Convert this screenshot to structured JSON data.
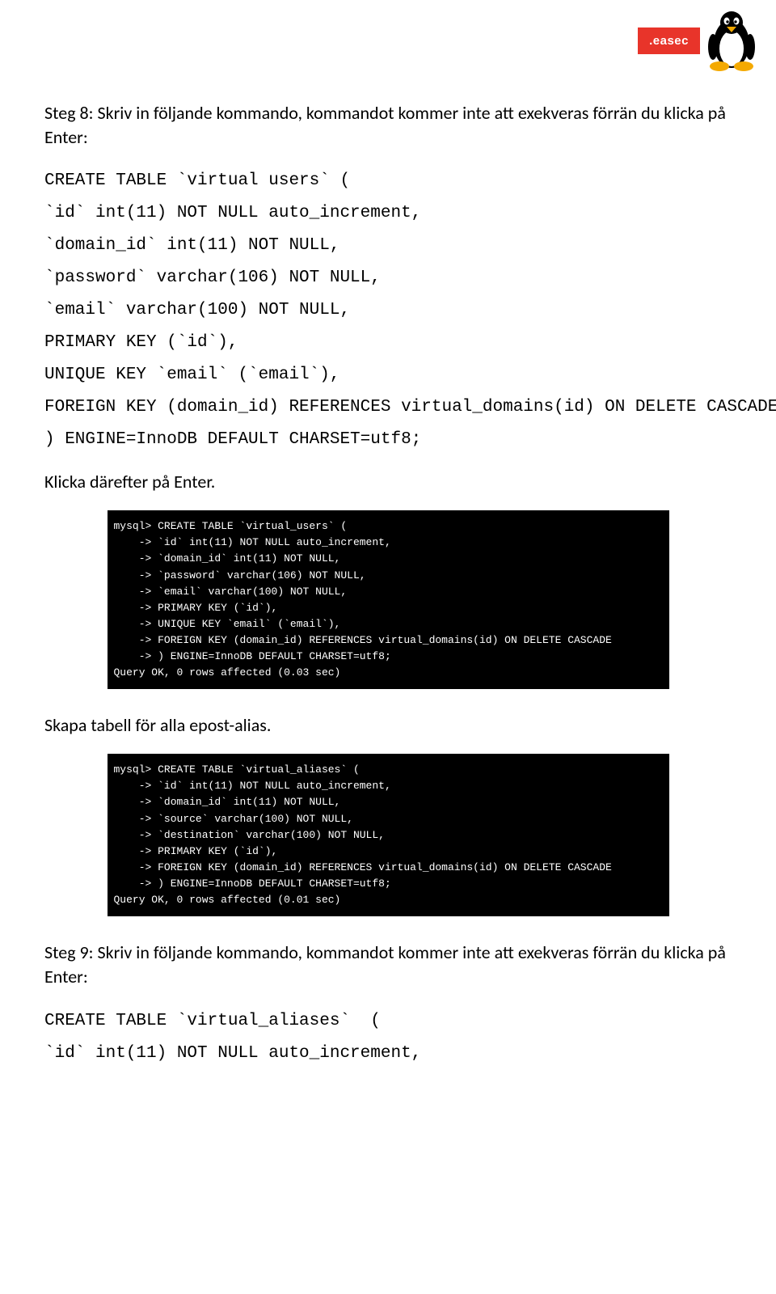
{
  "logo": {
    "badge_text": ".easec"
  },
  "step8": {
    "title": "Steg 8: Skriv in följande kommando, kommandot kommer inte att exekveras förrän du klicka på Enter:",
    "code_lines": [
      "CREATE TABLE `virtual users` (",
      "`id` int(11) NOT NULL auto_increment,",
      "`domain_id` int(11) NOT NULL,",
      "`password` varchar(106) NOT NULL,",
      "`email` varchar(100) NOT NULL,",
      "PRIMARY KEY (`id`),",
      "UNIQUE KEY `email` (`email`),",
      "FOREIGN KEY (domain_id) REFERENCES virtual_domains(id) ON DELETE CASCADE",
      ") ENGINE=InnoDB DEFAULT CHARSET=utf8;"
    ],
    "after_code": "Klicka därefter på Enter."
  },
  "terminal1_lines": [
    "mysql> CREATE TABLE `virtual_users` (",
    "    -> `id` int(11) NOT NULL auto_increment,",
    "    -> `domain_id` int(11) NOT NULL,",
    "    -> `password` varchar(106) NOT NULL,",
    "    -> `email` varchar(100) NOT NULL,",
    "    -> PRIMARY KEY (`id`),",
    "    -> UNIQUE KEY `email` (`email`),",
    "    -> FOREIGN KEY (domain_id) REFERENCES virtual_domains(id) ON DELETE CASCADE",
    "    -> ) ENGINE=InnoDB DEFAULT CHARSET=utf8;",
    "Query OK, 0 rows affected (0.03 sec)"
  ],
  "section2_title": "Skapa tabell för alla epost-alias.",
  "terminal2_lines": [
    "mysql> CREATE TABLE `virtual_aliases` (",
    "    -> `id` int(11) NOT NULL auto_increment,",
    "    -> `domain_id` int(11) NOT NULL,",
    "    -> `source` varchar(100) NOT NULL,",
    "    -> `destination` varchar(100) NOT NULL,",
    "    -> PRIMARY KEY (`id`),",
    "    -> FOREIGN KEY (domain_id) REFERENCES virtual_domains(id) ON DELETE CASCADE",
    "    -> ) ENGINE=InnoDB DEFAULT CHARSET=utf8;",
    "Query OK, 0 rows affected (0.01 sec)"
  ],
  "step9": {
    "title": "Steg 9: Skriv in följande kommando, kommandot kommer inte att exekveras förrän du klicka på Enter:",
    "code_lines": [
      "CREATE TABLE `virtual_aliases`  (",
      "`id` int(11) NOT NULL auto_increment,"
    ]
  }
}
